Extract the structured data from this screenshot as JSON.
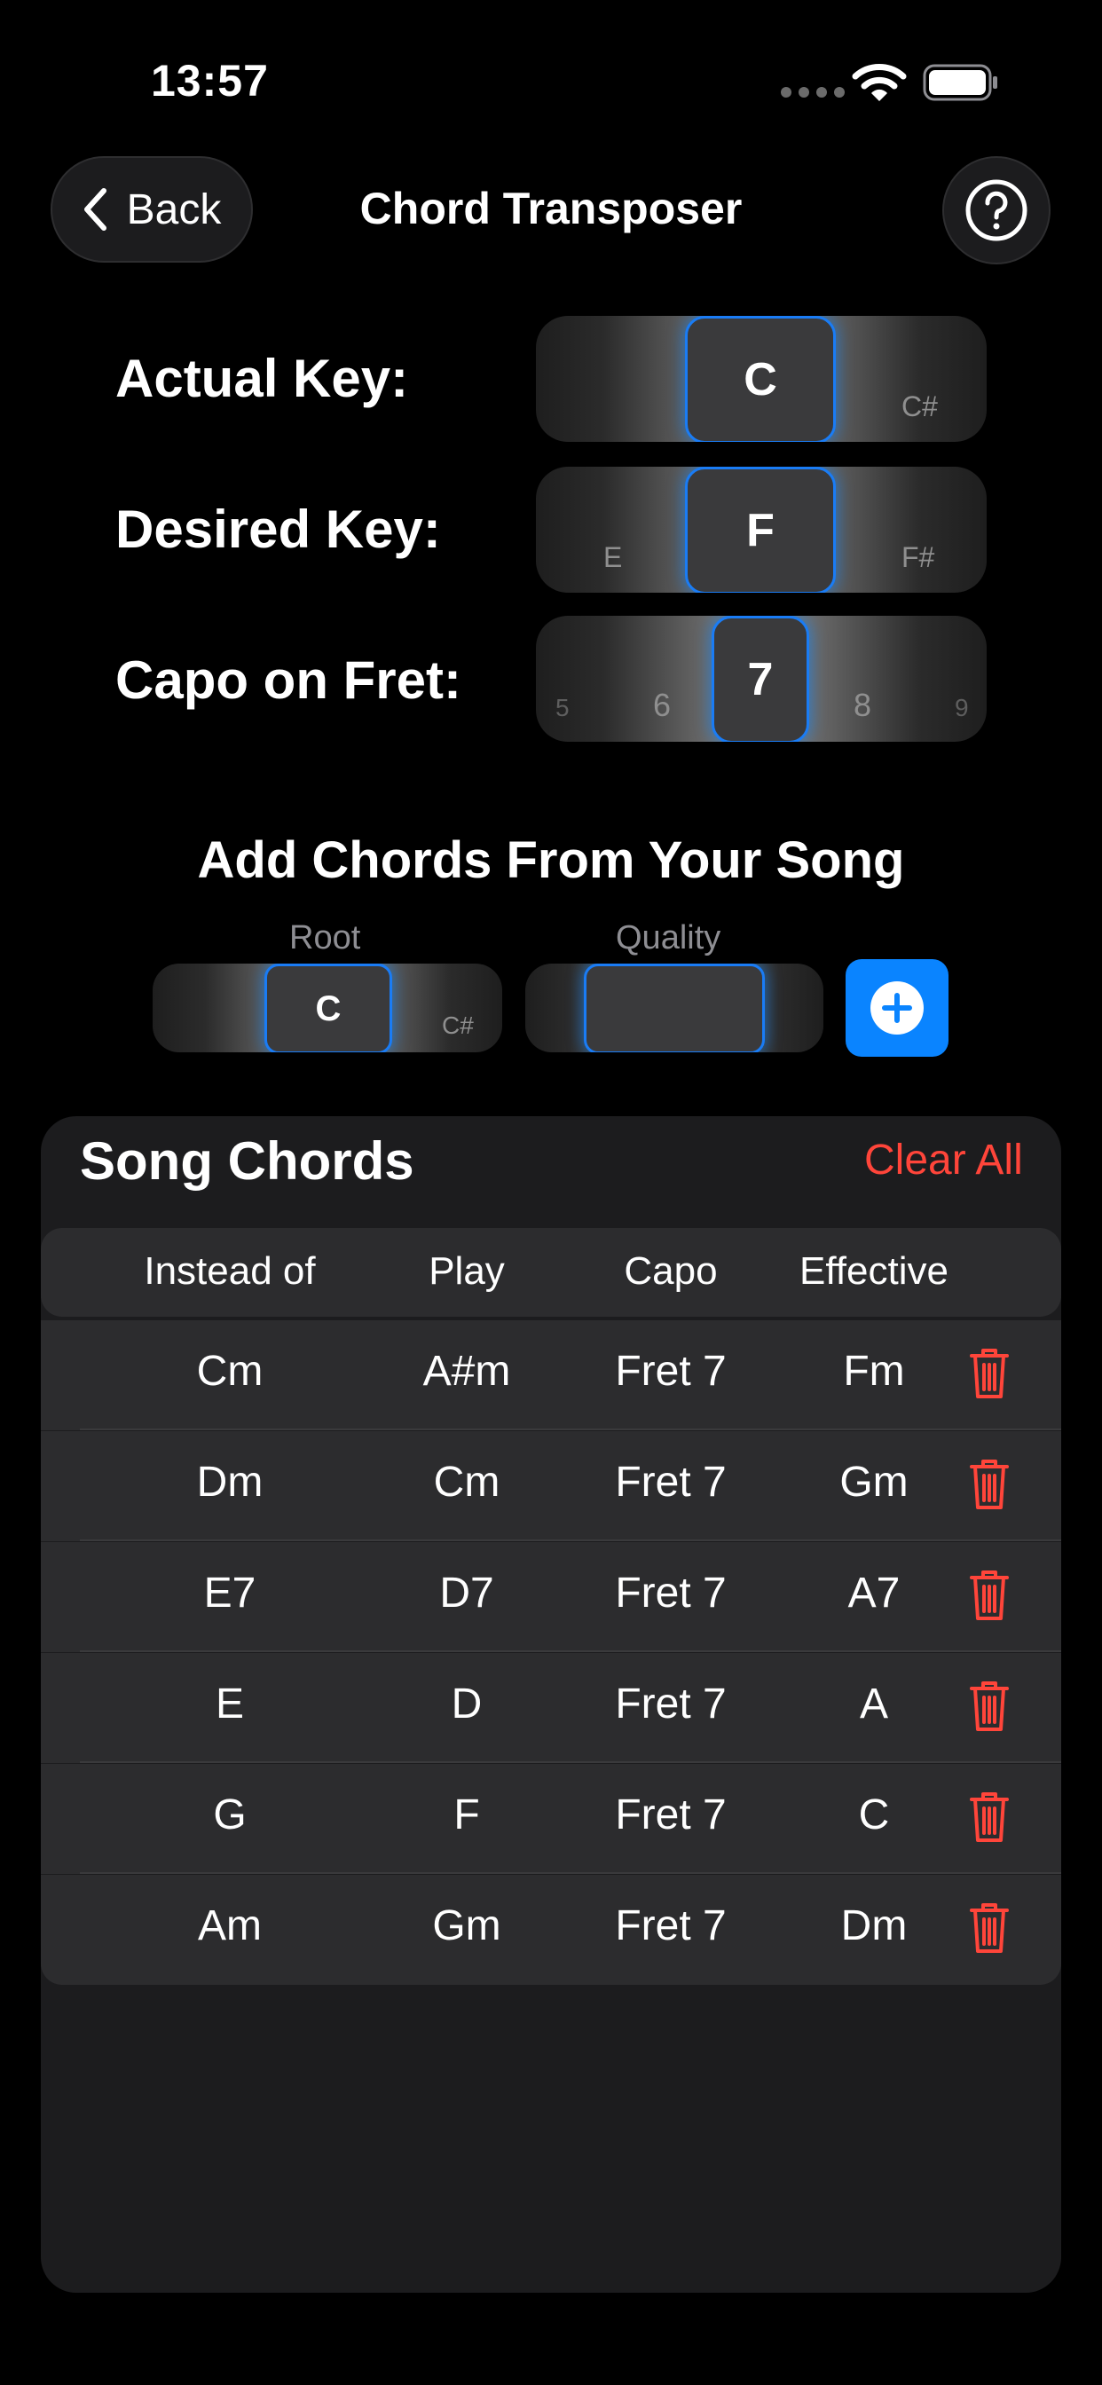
{
  "status_bar": {
    "time": "13:57"
  },
  "nav": {
    "back_label": "Back",
    "title": "Chord Transposer"
  },
  "keys": {
    "actual": {
      "label": "Actual Key:",
      "selected": "C",
      "next": "C#"
    },
    "desired": {
      "label": "Desired Key:",
      "prev": "E",
      "selected": "F",
      "next": "F#"
    },
    "capo": {
      "label": "Capo on Fret:",
      "far_prev": "5",
      "prev": "6",
      "selected": "7",
      "next": "8",
      "far_next": "9"
    }
  },
  "add_section": {
    "title": "Add Chords From Your Song",
    "root_label": "Root",
    "root_selected": "C",
    "root_next": "C#",
    "quality_label": "Quality",
    "quality_selected": ""
  },
  "song_chords": {
    "title": "Song Chords",
    "clear_label": "Clear All",
    "columns": [
      "Instead of",
      "Play",
      "Capo",
      "Effective"
    ],
    "rows": [
      {
        "instead": "Cm",
        "play": "A#m",
        "capo": "Fret 7",
        "effective": "Fm"
      },
      {
        "instead": "Dm",
        "play": "Cm",
        "capo": "Fret 7",
        "effective": "Gm"
      },
      {
        "instead": "E7",
        "play": "D7",
        "capo": "Fret 7",
        "effective": "A7"
      },
      {
        "instead": "E",
        "play": "D",
        "capo": "Fret 7",
        "effective": "A"
      },
      {
        "instead": "G",
        "play": "F",
        "capo": "Fret 7",
        "effective": "C"
      },
      {
        "instead": "Am",
        "play": "Gm",
        "capo": "Fret 7",
        "effective": "Dm"
      }
    ]
  },
  "colors": {
    "accent": "#0a84ff",
    "destructive": "#ff453a",
    "card": "#1c1c1e",
    "row": "#2c2c2e"
  },
  "icons": [
    "chevron-left-icon",
    "question-circle-icon",
    "plus-circle-icon",
    "trash-icon",
    "wifi-icon",
    "battery-icon"
  ]
}
